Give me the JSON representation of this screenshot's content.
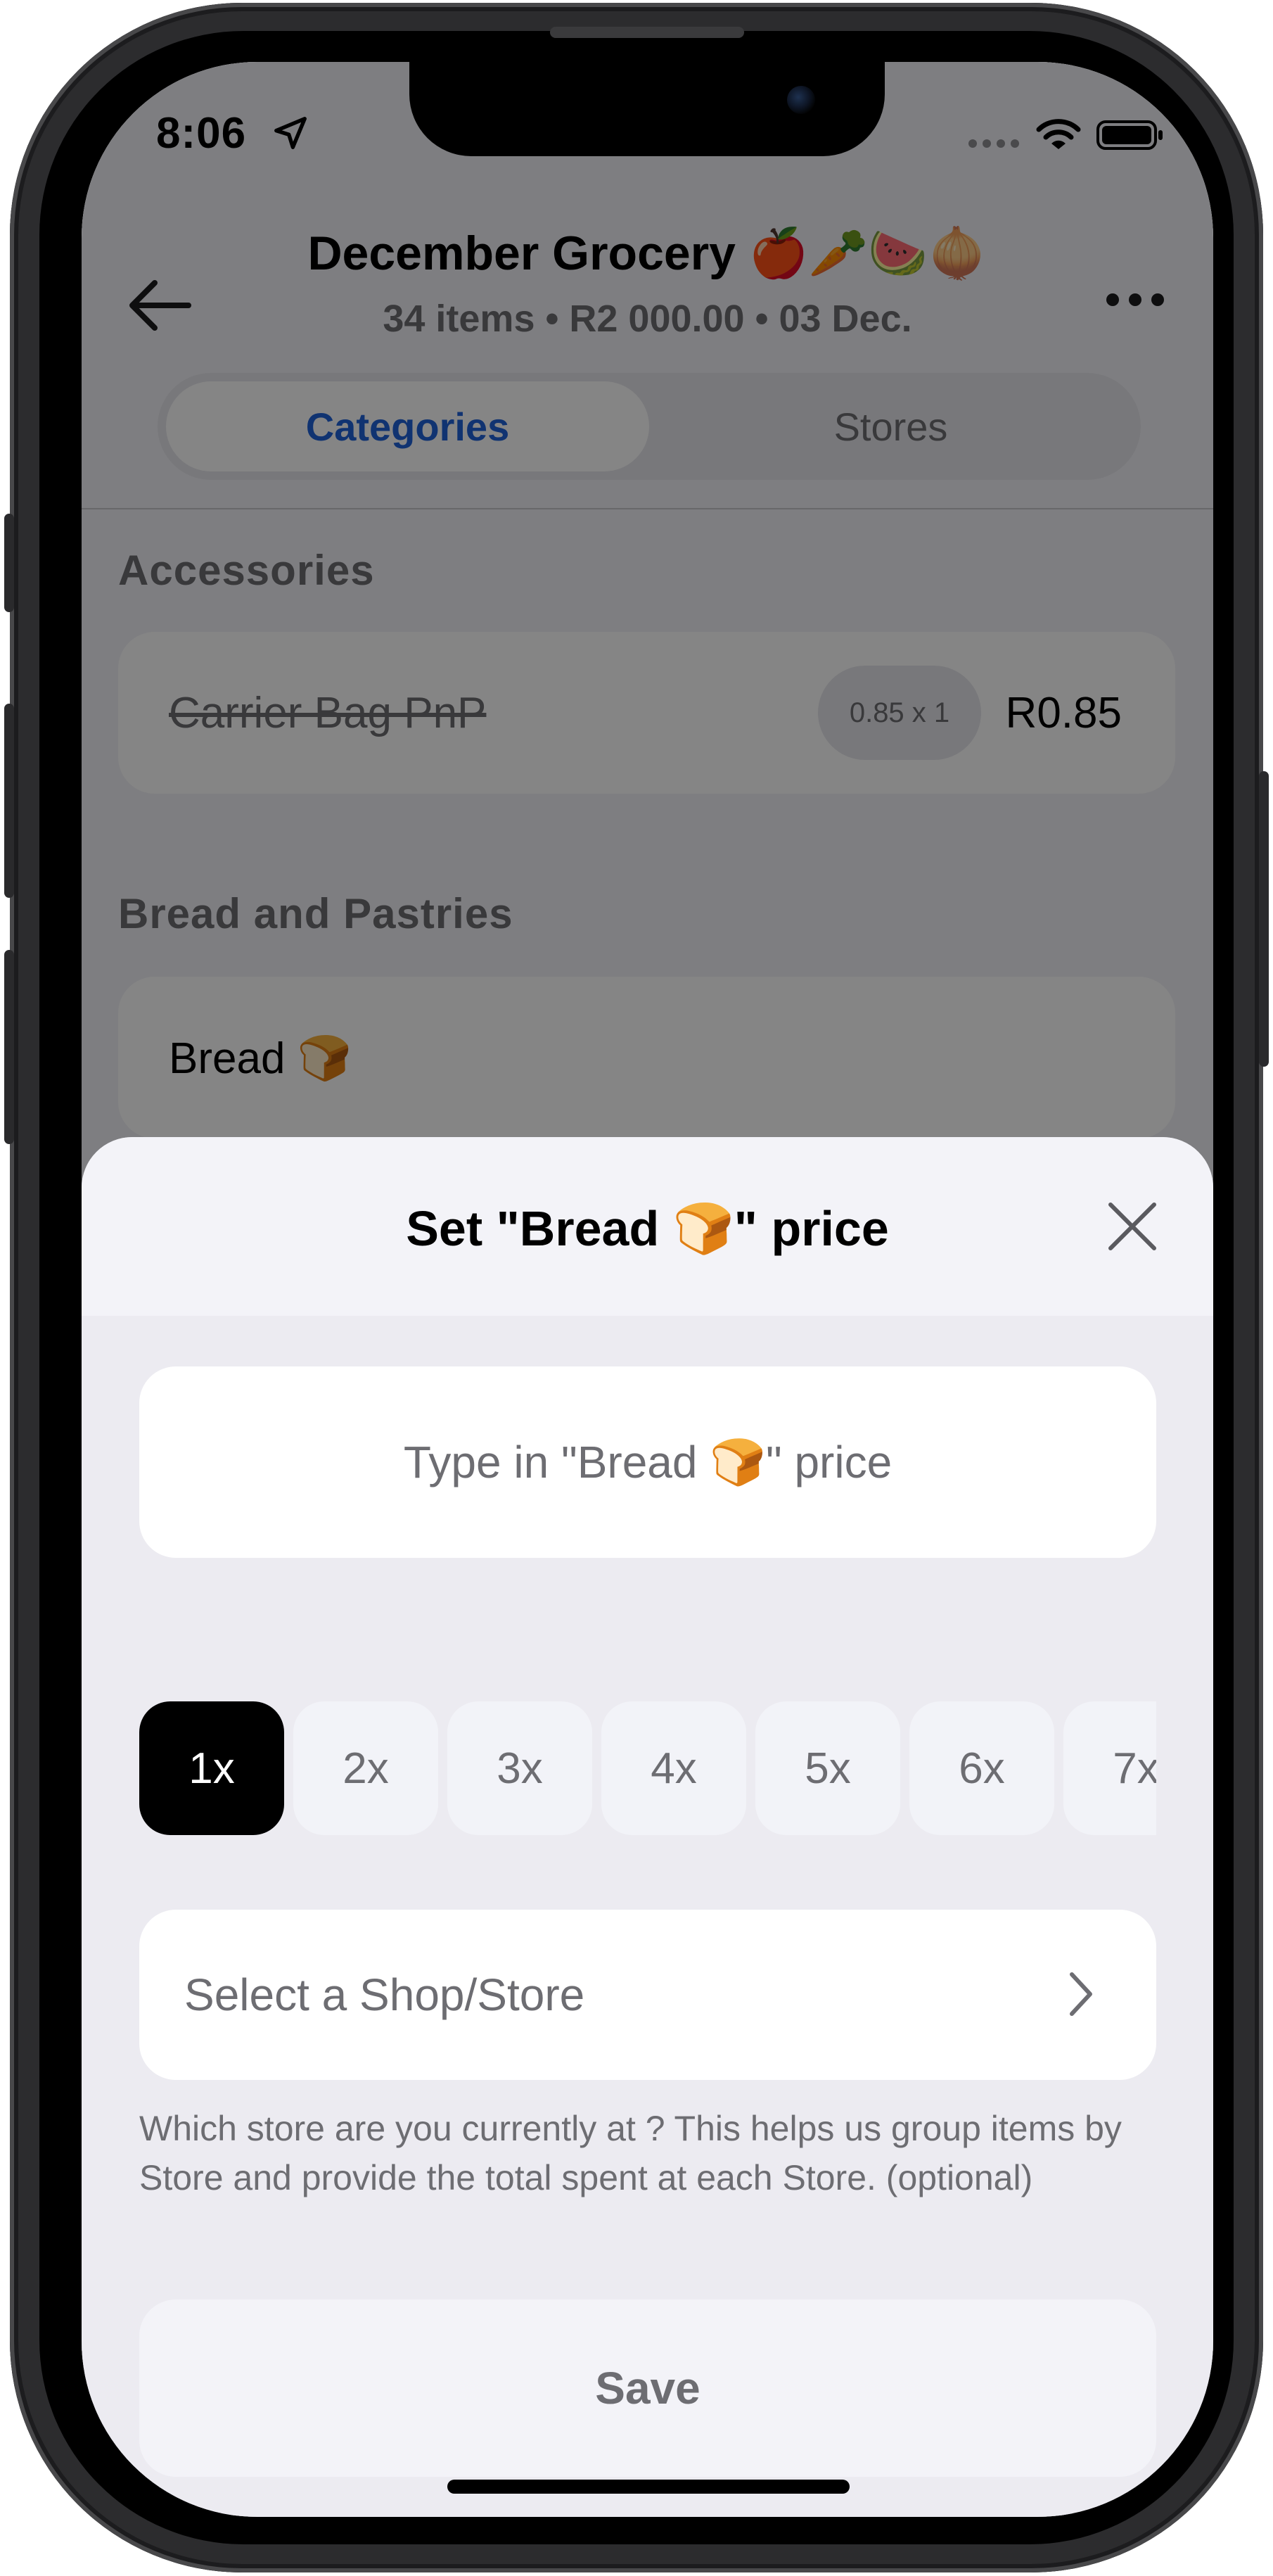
{
  "status_bar": {
    "time": "8:06",
    "icons": [
      "location-arrow-icon",
      "cellular-signal-icon",
      "wifi-icon",
      "battery-icon"
    ]
  },
  "header": {
    "back_icon": "arrow-left-icon",
    "title": "December Grocery 🍎🥕🍉🧅",
    "subtitle": "34 items • R2 000.00 • 03 Dec.",
    "more_icon": "more-horizontal-icon"
  },
  "tabs": [
    {
      "label": "Categories",
      "active": true
    },
    {
      "label": "Stores",
      "active": false
    }
  ],
  "sections": [
    {
      "title": "Accessories",
      "items": [
        {
          "name": "Carrier Bag PnP",
          "quantity": "0.85 x 1",
          "price": "R0.85",
          "checked": true
        }
      ]
    },
    {
      "title": "Bread and Pastries",
      "items": [
        {
          "name": "Bread 🍞"
        }
      ]
    }
  ],
  "sheet": {
    "title": "Set \"Bread 🍞\" price",
    "close_icon": "close-x-icon",
    "price_placeholder": "Type in \"Bread 🍞\" price",
    "price_value": "",
    "multipliers": [
      "1x",
      "2x",
      "3x",
      "4x",
      "5x",
      "6x",
      "7x"
    ],
    "selected_multiplier": "1x",
    "store_label": "Select a Shop/Store",
    "store_chevron_icon": "chevron-right-icon",
    "store_help": "Which store are you currently at ? This helps us group items by Store and provide the total spent at each Store. (optional)",
    "save_label": "Save"
  },
  "colors": {
    "accent": "#1f63d9",
    "selected_multiplier_bg": "#000000",
    "sheet_bg": "#ecebf1",
    "dim_overlay": "rgba(0,0,0,0.48)"
  }
}
